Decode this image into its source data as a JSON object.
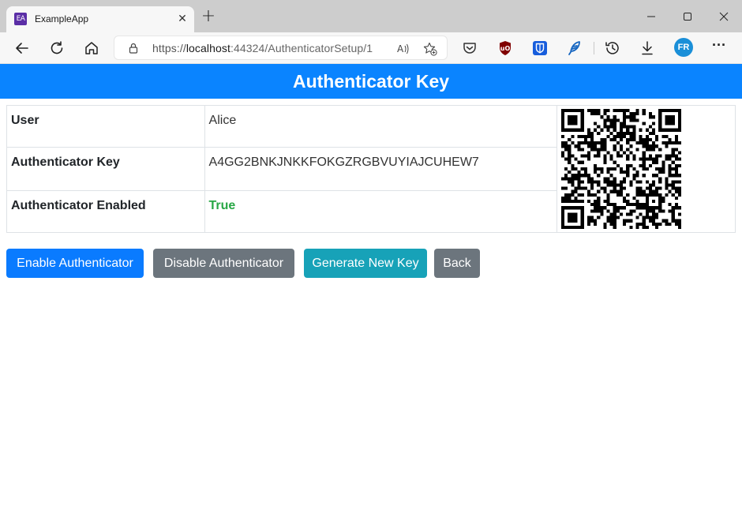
{
  "browser": {
    "tab": {
      "favicon_text": "EA",
      "title": "ExampleApp",
      "close_glyph": "✕"
    },
    "new_tab_glyph": "+",
    "window_controls": {
      "minimize": "—",
      "maximize": "☐",
      "close": "✕"
    },
    "address": {
      "scheme": "https://",
      "host": "localhost",
      "path": ":44324/AuthenticatorSetup/1"
    },
    "profile_initials": "FR",
    "more_glyph": "···",
    "icons": [
      "back-arrow-icon",
      "refresh-icon",
      "home-icon",
      "lock-icon",
      "read-aloud-icon",
      "favorites-icon",
      "pocket-icon",
      "ublock-icon",
      "bitwarden-icon",
      "feather-icon",
      "history-icon",
      "download-icon"
    ]
  },
  "page": {
    "title": "Authenticator Key",
    "rows": [
      {
        "label": "User",
        "value": "Alice"
      },
      {
        "label": "Authenticator Key",
        "value": "A4GG2BNKJNKKFOKGZRGBVUYIAJCUHEW7"
      },
      {
        "label": "Authenticator Enabled",
        "value": "True"
      }
    ],
    "buttons": {
      "enable": "Enable Authenticator",
      "disable": "Disable Authenticator",
      "generate": "Generate New Key",
      "back": "Back"
    }
  },
  "colors": {
    "header_bg": "#0a84ff",
    "primary": "#0a7bff",
    "secondary": "#6c757d",
    "info": "#17a2b8",
    "success_text": "#28a745"
  }
}
